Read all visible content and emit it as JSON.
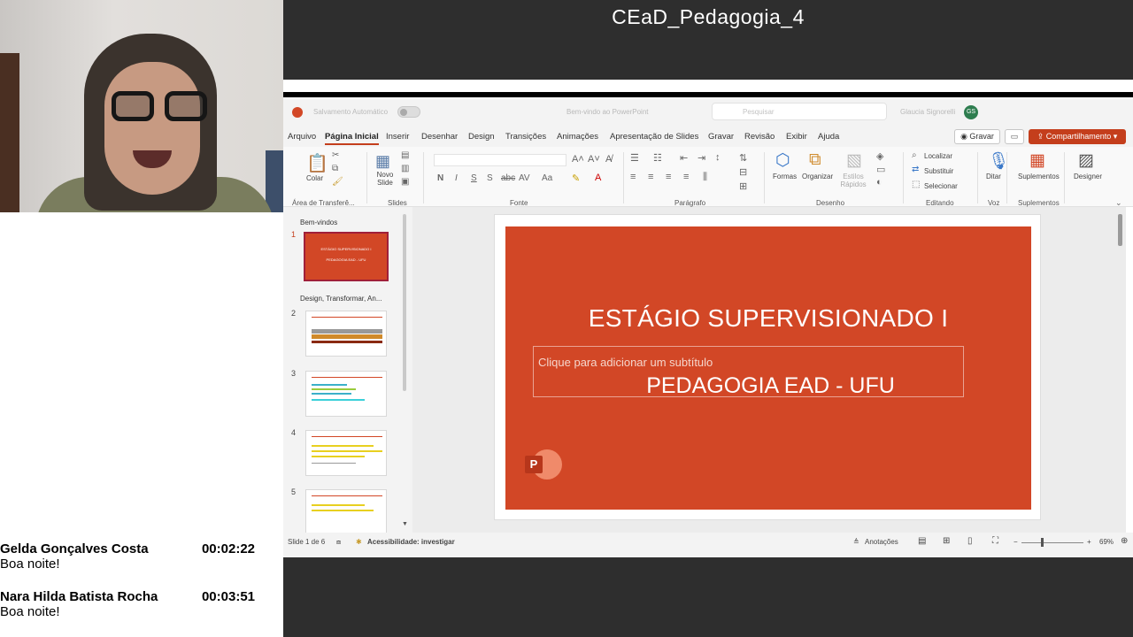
{
  "meeting": {
    "title": "CEaD_Pedagogia_4"
  },
  "chat": [
    {
      "name": "Gelda Gonçalves Costa",
      "time": "00:02:22",
      "text": "Boa noite!"
    },
    {
      "name": "Nara Hilda Batista Rocha",
      "time": "00:03:51",
      "text": "Boa noite!"
    }
  ],
  "ppt": {
    "titlebar": {
      "autosave": "Salvamento Automático",
      "filename": "Bem-vindo ao PowerPoint",
      "search_placeholder": "Pesquisar",
      "user_name": "Glaucia Signorelli",
      "user_initials": "GS"
    },
    "menu": [
      "Arquivo",
      "Página Inicial",
      "Inserir",
      "Desenhar",
      "Design",
      "Transições",
      "Animações",
      "Apresentação de Slides",
      "Gravar",
      "Revisão",
      "Exibir",
      "Ajuda"
    ],
    "record_button": "Gravar",
    "share_button": "Compartilhamento",
    "ribbon": {
      "paste": "Colar",
      "new_slide": "Novo Slide",
      "group_clipboard": "Área de Transferê...",
      "group_slides": "Slides",
      "group_font": "Fonte",
      "group_paragraph": "Parágrafo",
      "shapes": "Formas",
      "arrange": "Organizar",
      "quick_styles": "Estilos Rápidos",
      "group_drawing": "Desenho",
      "find": "Localizar",
      "replace": "Substituir",
      "select": "Selecionar",
      "group_editing": "Editando",
      "dictate": "Ditar",
      "group_voice": "Voz",
      "addins": "Suplementos",
      "group_addins": "Suplementos",
      "designer": "Designer"
    },
    "thumbnails": {
      "section1": "Bem-vindos",
      "section2": "Design, Transformar, An...",
      "numbers": [
        "1",
        "2",
        "3",
        "4",
        "5"
      ],
      "slide1_line1": "ESTÁGIO SUPERVISIONADO I",
      "slide1_line2": "PEDAGOGIA EAD - UFU"
    },
    "slide": {
      "title": "ESTÁGIO SUPERVISIONADO I",
      "subtitle_placeholder": "Clique para adicionar um subtítulo",
      "subtitle": "PEDAGOGIA EAD - UFU",
      "logo_letter": "P"
    },
    "status": {
      "slide_counter": "Slide 1 de 6",
      "accessibility": "Acessibilidade: investigar",
      "notes": "Anotações",
      "zoom": "69%"
    },
    "colors": {
      "accent": "#c43e1c",
      "slide_bg": "#d24726"
    }
  }
}
